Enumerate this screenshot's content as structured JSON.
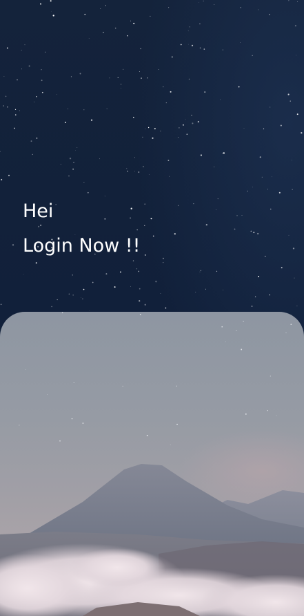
{
  "greeting": {
    "line1": "Hei",
    "line2": "Login Now !!"
  },
  "colors": {
    "sky_top": "#14233b",
    "sky_bottom": "#0f1b30",
    "text": "#ffffff",
    "panel_overlay": "#a9b0bb"
  }
}
